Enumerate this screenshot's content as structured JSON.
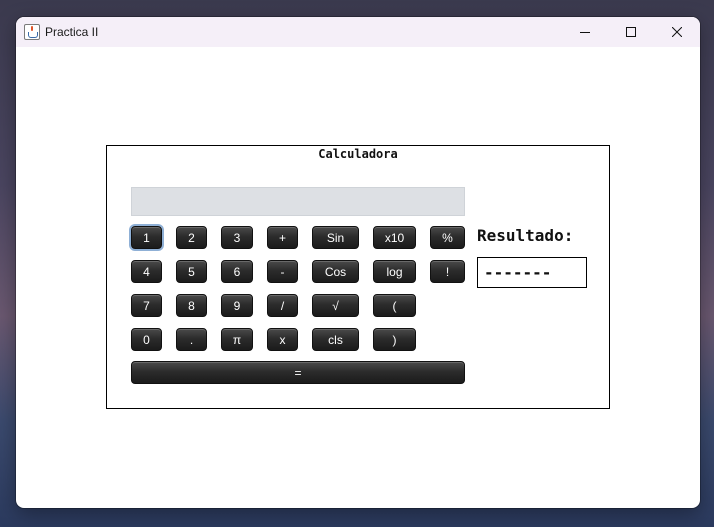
{
  "window": {
    "title": "Practica II",
    "icon": "java-cup-icon"
  },
  "calculator": {
    "title": "Calculadora",
    "display_value": "",
    "result_label": "Resultado:",
    "result_value": "-------",
    "keys": {
      "k1": "1",
      "k2": "2",
      "k3": "3",
      "plus": "+",
      "sin": "Sin",
      "x10": "x10",
      "percent": "%",
      "k4": "4",
      "k5": "5",
      "k6": "6",
      "minus": "-",
      "cos": "Cos",
      "log": "log",
      "factorial": "!",
      "k7": "7",
      "k8": "8",
      "k9": "9",
      "divide": "/",
      "sqrt": "√",
      "lparen": "(",
      "k0": "0",
      "dot": ".",
      "pi": "π",
      "multiply": "x",
      "cls": "cls",
      "rparen": ")",
      "equals": "="
    }
  }
}
